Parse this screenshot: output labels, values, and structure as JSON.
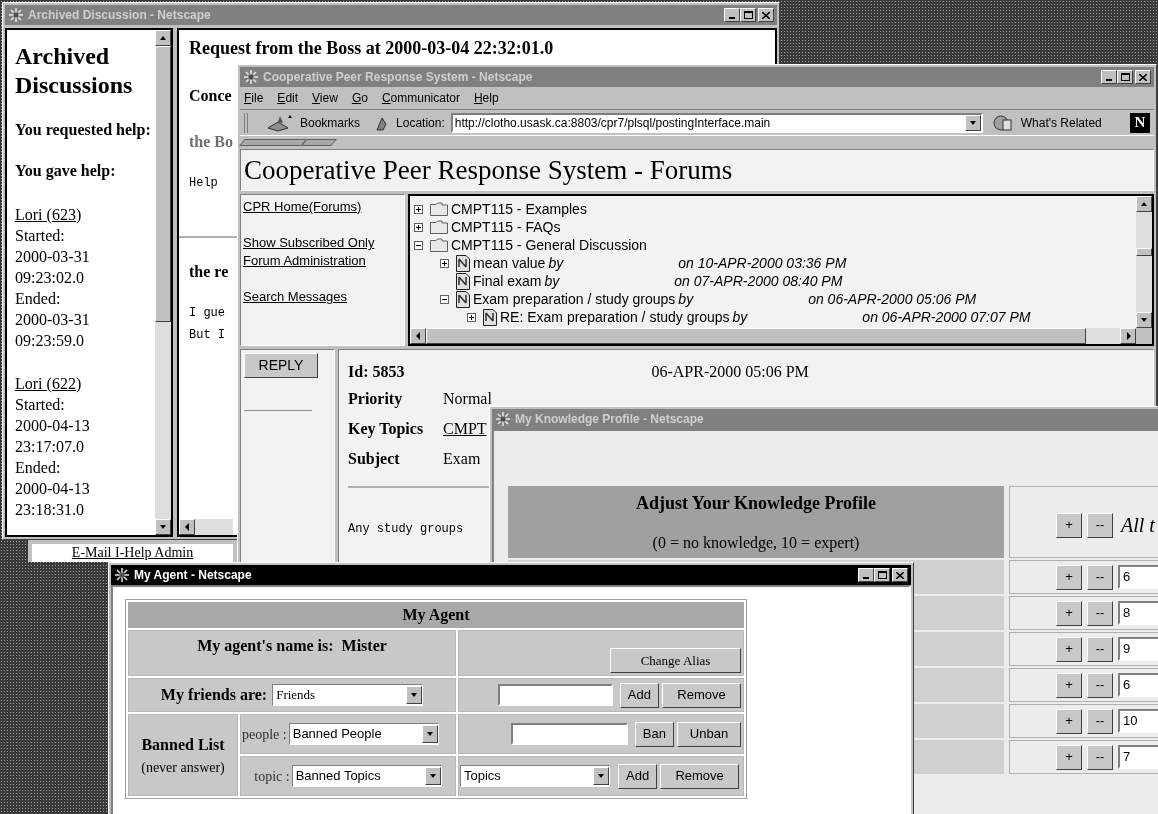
{
  "archived_window": {
    "title": "Archived Discussion - Netscape",
    "active": false,
    "sidebar": {
      "heading": "Archived Discussions",
      "sections": [
        "You requested help:",
        "You gave help:"
      ],
      "entries": [
        {
          "link": "Lori (623)",
          "lines": [
            "Started:",
            "2000-03-31",
            "09:23:02.0",
            "Ended:",
            "2000-03-31",
            "09:23:59.0"
          ]
        },
        {
          "link": "Lori (622)",
          "lines": [
            "Started:",
            "2000-04-13",
            "23:17:07.0",
            "Ended:",
            "2000-04-13",
            "23:18:31.0"
          ]
        }
      ]
    },
    "content": {
      "heading": "Request from the Boss at 2000-03-04 22:32:01.0",
      "lines": [
        {
          "kind": "bold",
          "text": "Conce"
        },
        {
          "kind": "gray",
          "text": "the Bo"
        },
        {
          "kind": "mono",
          "text": "Help"
        },
        {
          "kind": "rule"
        },
        {
          "kind": "bold",
          "text": "the re"
        },
        {
          "kind": "mono",
          "text": "I gue"
        },
        {
          "kind": "mono",
          "text": "But I"
        }
      ]
    },
    "footer_link": "E-Mail I-Help Admin"
  },
  "cpr_window": {
    "title": "Cooperative Peer Response System - Netscape",
    "active": false,
    "menu": [
      "File",
      "Edit",
      "View",
      "Go",
      "Communicator",
      "Help"
    ],
    "toolbar": {
      "bookmarks": "Bookmarks",
      "location_label": "Location:",
      "url": "http://clotho.usask.ca:8803/cpr7/plsql/postingInterface.main",
      "whats_related": "What's Related",
      "logo": "N"
    },
    "page_title": "Cooperative Peer Response System - Forums",
    "nav_links": [
      "CPR Home(Forums)",
      "Show Subscribed Only",
      "Forum Administration",
      "Search Messages"
    ],
    "tree": [
      {
        "kind": "folder",
        "title": "CMPT115 - Examples",
        "expandable": true,
        "expanded": false
      },
      {
        "kind": "folder",
        "title": "CMPT115 - FAQs",
        "expandable": true,
        "expanded": false
      },
      {
        "kind": "folder",
        "title": "CMPT115 - General Discussion",
        "expandable": true,
        "expanded": true,
        "children": [
          {
            "kind": "post",
            "title": "mean value",
            "by": "by",
            "date": "on 10-APR-2000 03:36 PM",
            "expandable": true,
            "expanded": false
          },
          {
            "kind": "post",
            "title": "Final exam",
            "by": "by",
            "date": "on 07-APR-2000 08:40 PM",
            "expandable": false
          },
          {
            "kind": "post",
            "title": "Exam preparation / study groups",
            "by": "by",
            "date": "on 06-APR-2000 05:06 PM",
            "expandable": true,
            "expanded": true,
            "children": [
              {
                "kind": "post",
                "title": "RE: Exam preparation / study groups",
                "by": "by",
                "date": "on 06-APR-2000 07:07 PM",
                "expandable": true,
                "expanded": false
              }
            ]
          }
        ]
      }
    ],
    "reply_button": "REPLY",
    "message": {
      "id_label": "Id: 5853",
      "date": "06-APR-2000 05:06 PM",
      "fields": [
        {
          "label": "Priority",
          "value": "Normal",
          "link": false
        },
        {
          "label": "Key Topics",
          "value": "CMPT",
          "link": true
        },
        {
          "label": "Subject",
          "value": "Exam",
          "link": false
        }
      ],
      "body": "Any study groups"
    }
  },
  "knowledge_window": {
    "title": "My Knowledge Profile - Netscape",
    "active": false,
    "heading": "Adjust Your Knowledge Profile",
    "scale_note": "(0 = no knowledge, 10 = expert)",
    "all_topics": {
      "plus": "+",
      "minus": "--",
      "label": "All t"
    },
    "rows": [
      {
        "plus": "+",
        "minus": "--",
        "value": "6"
      },
      {
        "plus": "+",
        "minus": "--",
        "value": "8"
      },
      {
        "plus": "+",
        "minus": "--",
        "value": "9"
      },
      {
        "plus": "+",
        "minus": "--",
        "value": "6"
      },
      {
        "plus": "+",
        "minus": "--",
        "value": "10"
      },
      {
        "plus": "+",
        "minus": "--",
        "value": "7"
      }
    ]
  },
  "agent_window": {
    "title": "My Agent - Netscape",
    "active": true,
    "heading": "My Agent",
    "name_text": "My agent's name is:  Mister",
    "change_alias": "Change Alias",
    "friends_label": "My friends are:",
    "friends_select": "Friends",
    "friends_add": "Add",
    "friends_remove": "Remove",
    "banned_label": "Banned List",
    "banned_note": "(never answer)",
    "people_label": "people :",
    "people_select": "Banned People",
    "ban": "Ban",
    "unban": "Unban",
    "topic_label": "topic :",
    "topic_select": "Banned Topics",
    "topics_select": "Topics",
    "topic_add": "Add",
    "topic_remove": "Remove"
  }
}
